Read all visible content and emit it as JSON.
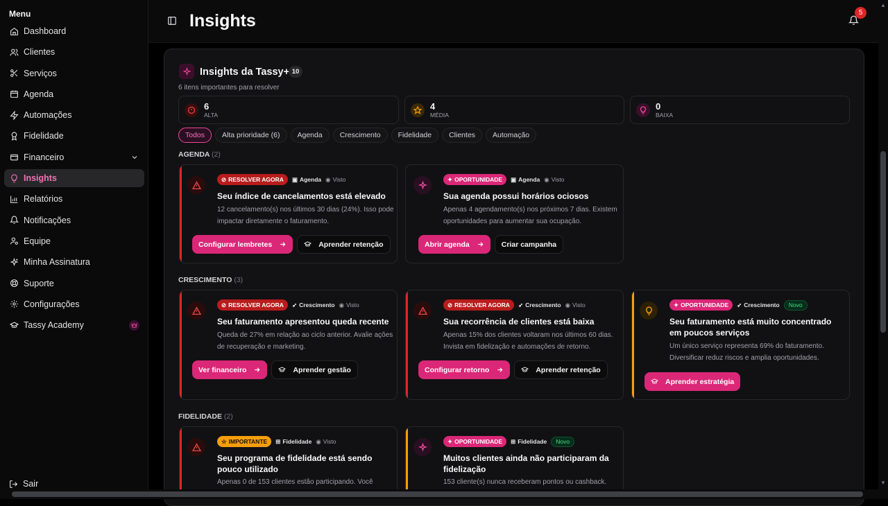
{
  "sidebar": {
    "title": "Menu",
    "items": [
      {
        "label": "Dashboard",
        "icon": "home-icon"
      },
      {
        "label": "Clientes",
        "icon": "users-icon"
      },
      {
        "label": "Serviços",
        "icon": "scissors-icon"
      },
      {
        "label": "Agenda",
        "icon": "calendar-icon"
      },
      {
        "label": "Automações",
        "icon": "zap-icon"
      },
      {
        "label": "Fidelidade",
        "icon": "award-icon"
      },
      {
        "label": "Financeiro",
        "icon": "wallet-icon"
      },
      {
        "label": "Insights",
        "icon": "lightbulb-icon"
      },
      {
        "label": "Relatórios",
        "icon": "bar-chart-icon"
      },
      {
        "label": "Notificações",
        "icon": "bell-icon"
      },
      {
        "label": "Equipe",
        "icon": "user-cog-icon"
      },
      {
        "label": "Minha Assinatura",
        "icon": "sparkles-icon"
      },
      {
        "label": "Suporte",
        "icon": "lifebuoy-icon"
      },
      {
        "label": "Configurações",
        "icon": "gear-icon"
      },
      {
        "label": "Tassy Academy",
        "icon": "graduation-cap-icon"
      }
    ],
    "active_item": "Insights",
    "logout": "Sair"
  },
  "header": {
    "title": "Insights",
    "notifications_count": "5"
  },
  "panel": {
    "title": "Insights da Tassy+",
    "count": "10",
    "subtitle": "6 itens importantes para resolver",
    "stats": [
      {
        "value": "6",
        "label": "ALTA",
        "color": "#ef4444"
      },
      {
        "value": "4",
        "label": "MÉDIA",
        "color": "#f59e0b"
      },
      {
        "value": "0",
        "label": "BAIXA",
        "color": "#ec4899"
      }
    ],
    "filters": [
      "Todos",
      "Alta prioridade (6)",
      "Agenda",
      "Crescimento",
      "Fidelidade",
      "Clientes",
      "Automação"
    ],
    "active_filter": "Todos"
  },
  "sections": {
    "agenda": {
      "label": "AGENDA",
      "count": "(2)"
    },
    "crescimento": {
      "label": "CRESCIMENTO",
      "count": "(3)"
    },
    "fidelidade": {
      "label": "FIDELIDADE",
      "count": "(2)"
    }
  },
  "cards": {
    "c1": {
      "badge": "RESOLVER AGORA",
      "tag": "Agenda",
      "visto": "Visto",
      "title": "Seu índice de cancelamentos está elevado",
      "desc": "12 cancelamento(s) nos últimos 30 dias (24%). Isso pode impactar diretamente o faturamento.",
      "primary": "Configurar lembretes",
      "secondary": "Aprender retenção"
    },
    "c2": {
      "badge": "OPORTUNIDADE",
      "tag": "Agenda",
      "visto": "Visto",
      "title": "Sua agenda possui horários ociosos",
      "desc": "Apenas 4 agendamento(s) nos próximos 7 dias. Existem oportunidades para aumentar sua ocupação.",
      "primary": "Abrir agenda",
      "secondary": "Criar campanha"
    },
    "c3": {
      "badge": "RESOLVER AGORA",
      "tag": "Crescimento",
      "visto": "Visto",
      "title": "Seu faturamento apresentou queda recente",
      "desc": "Queda de 27% em relação ao ciclo anterior. Avalie ações de recuperação e marketing.",
      "primary": "Ver financeiro",
      "secondary": "Aprender gestão"
    },
    "c4": {
      "badge": "RESOLVER AGORA",
      "tag": "Crescimento",
      "visto": "Visto",
      "title": "Sua recorrência de clientes está baixa",
      "desc": "Apenas 15% dos clientes voltaram nos últimos 60 dias. Invista em fidelização e automações de retorno.",
      "primary": "Configurar retorno",
      "secondary": "Aprender retenção"
    },
    "c5": {
      "badge": "OPORTUNIDADE",
      "tag": "Crescimento",
      "novo": "Novo",
      "title": "Seu faturamento está muito concentrado em poucos serviços",
      "desc": "Um único serviço representa 69% do faturamento. Diversificar reduz riscos e amplia oportunidades.",
      "primary": "Aprender estratégia"
    },
    "c6": {
      "badge": "IMPORTANTE",
      "tag": "Fidelidade",
      "visto": "Visto",
      "title": "Seu programa de fidelidade está sendo pouco utilizado",
      "desc": "Apenas 0 de 153 clientes estão participando. Você"
    },
    "c7": {
      "badge": "OPORTUNIDADE",
      "tag": "Fidelidade",
      "novo": "Novo",
      "title": "Muitos clientes ainda não participaram da fidelização",
      "desc": "153 cliente(s) nunca receberam pontos ou cashback."
    }
  },
  "colors": {
    "accent": "#db2777",
    "danger": "#dc2626",
    "warning": "#f59e0b"
  }
}
